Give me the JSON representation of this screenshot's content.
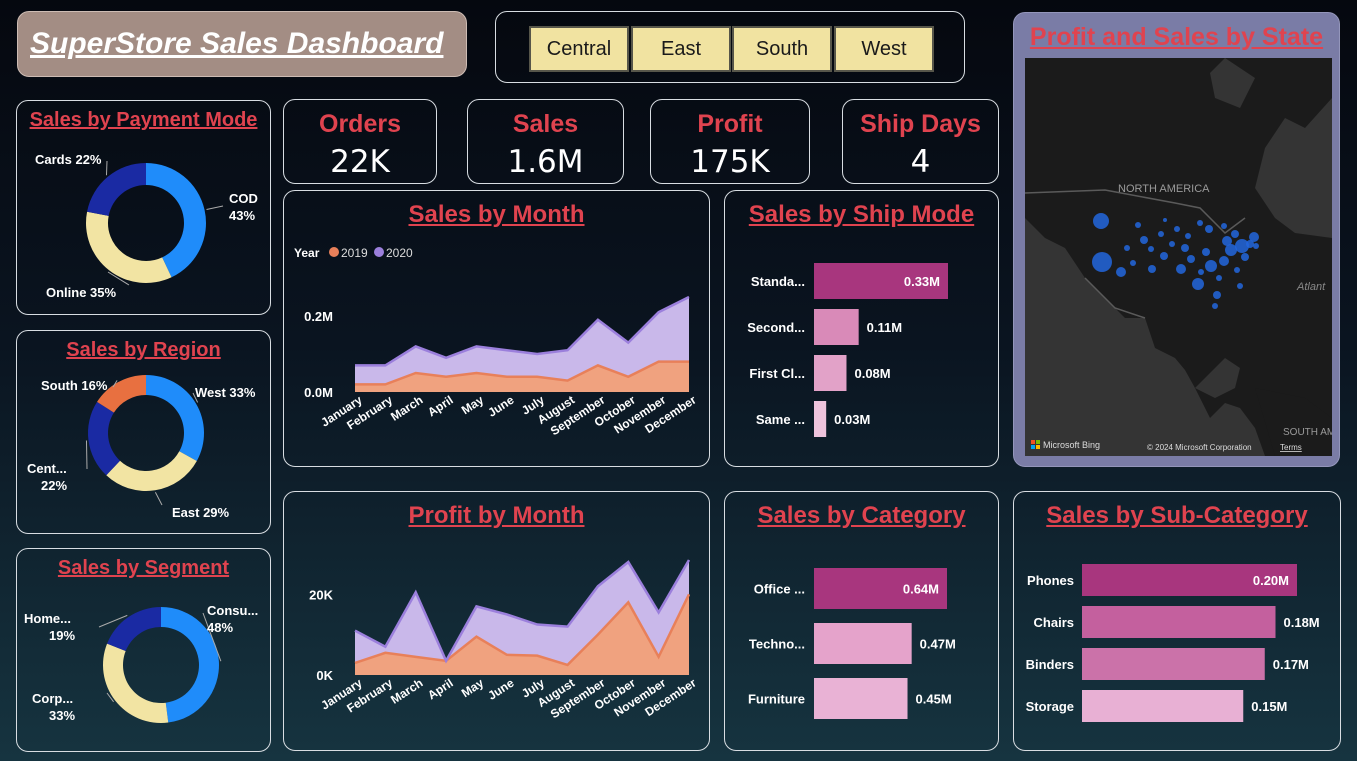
{
  "dashboard": {
    "title": "SuperStore Sales Dashboard"
  },
  "regions": [
    "Central",
    "East",
    "South",
    "West"
  ],
  "kpis": [
    {
      "label": "Orders",
      "value": "22K"
    },
    {
      "label": "Sales",
      "value": "1.6M"
    },
    {
      "label": "Profit",
      "value": "175K"
    },
    {
      "label": "Ship Days",
      "value": "4"
    }
  ],
  "panels": {
    "payment": "Sales by Payment Mode",
    "region": "Sales by Region",
    "segment": "Sales by Segment",
    "sales_month": "Sales by Month",
    "profit_month": "Profit by Month",
    "ship_mode": "Sales by Ship Mode",
    "category": "Sales by Category",
    "subcategory": "Sales by Sub-Category",
    "map": "Profit and Sales by State"
  },
  "map": {
    "label_na": "NORTH AMERICA",
    "label_atl": "Atlant",
    "label_sa": "SOUTH AME",
    "brand": "Microsoft Bing",
    "copyright": "© 2024 Microsoft Corporation",
    "terms": "Terms"
  },
  "colors": {
    "blue": "#1f8cfa",
    "navy": "#1a2aa3",
    "cream": "#f2e4a3",
    "orange": "#e87040",
    "magenta": "#a8367e",
    "accent": "#e0434f"
  },
  "chart_data": [
    {
      "id": "payment",
      "type": "pie",
      "slices": [
        {
          "name": "COD",
          "value": 43,
          "line1": "COD",
          "line2": "43%",
          "color": "#1f8cfa"
        },
        {
          "name": "Online",
          "value": 35,
          "line1": "Online 35%",
          "line2": "",
          "color": "#f2e4a3"
        },
        {
          "name": "Cards",
          "value": 22,
          "line1": "Cards 22%",
          "line2": "",
          "color": "#1a2aa3"
        }
      ]
    },
    {
      "id": "region",
      "type": "pie",
      "slices": [
        {
          "name": "West",
          "value": 33,
          "line1": "West 33%",
          "line2": "",
          "color": "#1f8cfa"
        },
        {
          "name": "East",
          "value": 29,
          "line1": "East 29%",
          "line2": "",
          "color": "#f2e4a3"
        },
        {
          "name": "Central",
          "value": 22,
          "line1": "Cent...",
          "line2": "22%",
          "color": "#1a2aa3"
        },
        {
          "name": "South",
          "value": 16,
          "line1": "South 16%",
          "line2": "",
          "color": "#e87040"
        }
      ]
    },
    {
      "id": "segment",
      "type": "pie",
      "slices": [
        {
          "name": "Consumer",
          "value": 48,
          "line1": "Consu...",
          "line2": "48%",
          "color": "#1f8cfa"
        },
        {
          "name": "Corporate",
          "value": 33,
          "line1": "Corp...",
          "line2": "33%",
          "color": "#f2e4a3"
        },
        {
          "name": "Home Office",
          "value": 19,
          "line1": "Home...",
          "line2": "19%",
          "color": "#1a2aa3"
        }
      ]
    },
    {
      "id": "sales_month",
      "type": "area",
      "legend_title": "Year",
      "categories": [
        "January",
        "February",
        "March",
        "April",
        "May",
        "June",
        "July",
        "August",
        "September",
        "October",
        "November",
        "December"
      ],
      "ylim": [
        0,
        0.25
      ],
      "yticks": [
        0,
        0.2
      ],
      "ytick_labels": [
        "0.0M",
        "0.2M"
      ],
      "series": [
        {
          "name": "2019",
          "color": "#e8805a",
          "fill": "#f0a27f",
          "values": [
            0.02,
            0.02,
            0.05,
            0.04,
            0.05,
            0.04,
            0.04,
            0.03,
            0.07,
            0.04,
            0.08,
            0.08
          ]
        },
        {
          "name": "2020",
          "color": "#9b7fdc",
          "fill": "#c9b8ea",
          "values": [
            0.07,
            0.07,
            0.12,
            0.09,
            0.12,
            0.11,
            0.1,
            0.11,
            0.19,
            0.13,
            0.21,
            0.25
          ]
        }
      ]
    },
    {
      "id": "profit_month",
      "type": "area",
      "categories": [
        "January",
        "February",
        "March",
        "April",
        "May",
        "June",
        "July",
        "August",
        "September",
        "October",
        "November",
        "December"
      ],
      "ylim": [
        0,
        28000
      ],
      "yticks": [
        0,
        20000
      ],
      "ytick_labels": [
        "0K",
        "20K"
      ],
      "series": [
        {
          "name": "2019",
          "color": "#e8805a",
          "fill": "#f0a27f",
          "values": [
            3000,
            5500,
            4500,
            3500,
            9500,
            5000,
            4800,
            2500,
            10000,
            18000,
            4500,
            20000
          ]
        },
        {
          "name": "2020",
          "color": "#9b7fdc",
          "fill": "#c9b8ea",
          "values": [
            11000,
            7000,
            20500,
            3500,
            17000,
            15000,
            12500,
            12000,
            22000,
            28000,
            15500,
            28500
          ]
        }
      ]
    },
    {
      "id": "ship_mode",
      "type": "bar",
      "orientation": "horizontal",
      "categories": [
        "Standa...",
        "Second...",
        "First Cl...",
        "Same ..."
      ],
      "values": [
        0.33,
        0.11,
        0.08,
        0.03
      ],
      "value_labels": [
        "0.33M",
        "0.11M",
        "0.08M",
        "0.03M"
      ],
      "colors": [
        "#a8367e",
        "#d98ab8",
        "#e2a2c8",
        "#eec3dc"
      ],
      "xlim": [
        0,
        0.33
      ]
    },
    {
      "id": "category",
      "type": "bar",
      "orientation": "horizontal",
      "categories": [
        "Office ...",
        "Techno...",
        "Furniture"
      ],
      "values": [
        0.64,
        0.47,
        0.45
      ],
      "value_labels": [
        "0.64M",
        "0.47M",
        "0.45M"
      ],
      "colors": [
        "#a8367e",
        "#e5a3cb",
        "#e9b2d5"
      ],
      "xlim": [
        0,
        0.64
      ]
    },
    {
      "id": "subcategory",
      "type": "bar",
      "orientation": "horizontal",
      "categories": [
        "Phones",
        "Chairs",
        "Binders",
        "Storage"
      ],
      "values": [
        0.2,
        0.18,
        0.17,
        0.15
      ],
      "value_labels": [
        "0.20M",
        "0.18M",
        "0.17M",
        "0.15M"
      ],
      "colors": [
        "#a8367e",
        "#c4609e",
        "#cb72a9",
        "#e8b0d4"
      ],
      "xlim": [
        0,
        0.2
      ]
    }
  ]
}
